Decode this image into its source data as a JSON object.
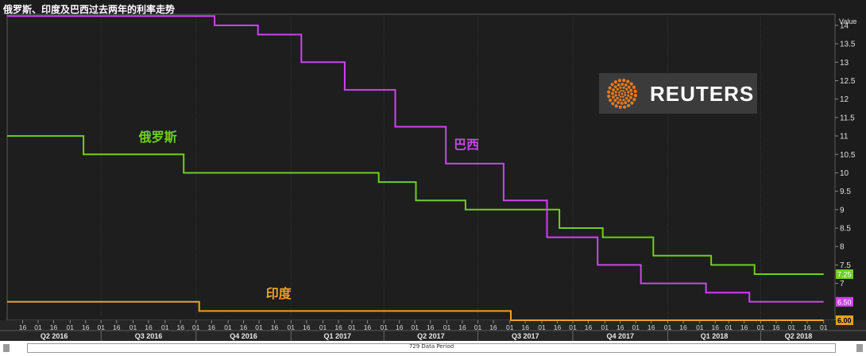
{
  "title": "俄罗斯、印度及巴西过去两年的利率走势",
  "status_bar": {
    "period_label": "729 Data Period"
  },
  "logo": {
    "text": "REUTERS"
  },
  "chart_data": {
    "type": "line",
    "ylabel": "Value",
    "ylim": [
      6,
      14.3
    ],
    "yticks": [
      7,
      7.5,
      8,
      8.5,
      9,
      9.5,
      10,
      10.5,
      11,
      11.5,
      12,
      12.5,
      13,
      13.5,
      14
    ],
    "ytick_labels": [
      "7",
      "7.5",
      "8",
      "8.5",
      "9",
      "9.5",
      "10",
      "10.5",
      "11",
      "11.5",
      "12",
      "12.5",
      "13",
      "13.5",
      "14"
    ],
    "x_range": [
      "2016-04-01",
      "2018-06-12"
    ],
    "x_day_ticks": [
      "2016-04-16",
      "2016-05-01",
      "2016-05-16",
      "2016-06-01",
      "2016-06-16",
      "2016-07-01",
      "2016-07-16",
      "2016-08-01",
      "2016-08-16",
      "2016-09-01",
      "2016-09-16",
      "2016-10-01",
      "2016-10-16",
      "2016-11-01",
      "2016-11-16",
      "2016-12-01",
      "2016-12-16",
      "2017-01-01",
      "2017-01-16",
      "2017-02-01",
      "2017-02-16",
      "2017-03-01",
      "2017-03-16",
      "2017-04-01",
      "2017-04-16",
      "2017-05-01",
      "2017-05-16",
      "2017-06-01",
      "2017-06-16",
      "2017-07-01",
      "2017-07-16",
      "2017-08-01",
      "2017-08-16",
      "2017-09-01",
      "2017-09-16",
      "2017-10-01",
      "2017-10-16",
      "2017-11-01",
      "2017-11-16",
      "2017-12-01",
      "2017-12-16",
      "2018-01-01",
      "2018-01-16",
      "2018-02-01",
      "2018-02-16",
      "2018-03-01",
      "2018-03-16",
      "2018-04-01",
      "2018-04-16",
      "2018-05-01",
      "2018-05-16",
      "2018-06-01"
    ],
    "quarters": [
      {
        "label": "Q2 2016",
        "start": "2016-04-01"
      },
      {
        "label": "Q3 2016",
        "start": "2016-07-01"
      },
      {
        "label": "Q4 2016",
        "start": "2016-10-01"
      },
      {
        "label": "Q1 2017",
        "start": "2017-01-01"
      },
      {
        "label": "Q2 2017",
        "start": "2017-04-01"
      },
      {
        "label": "Q3 2017",
        "start": "2017-07-01"
      },
      {
        "label": "Q4 2017",
        "start": "2017-10-01"
      },
      {
        "label": "Q1 2018",
        "start": "2018-01-01"
      },
      {
        "label": "Q2 2018",
        "start": "2018-04-01"
      }
    ],
    "series": [
      {
        "name": "俄罗斯",
        "color": "#6fcf1f",
        "last_value_label": "7.25",
        "label_position": {
          "date": "2016-08-25",
          "value": 10.85
        },
        "points": [
          [
            "2016-04-01",
            11
          ],
          [
            "2016-06-14",
            11
          ],
          [
            "2016-06-14",
            10.5
          ],
          [
            "2016-09-19",
            10.5
          ],
          [
            "2016-09-19",
            10
          ],
          [
            "2017-03-27",
            10
          ],
          [
            "2017-03-27",
            9.75
          ],
          [
            "2017-05-02",
            9.75
          ],
          [
            "2017-05-02",
            9.25
          ],
          [
            "2017-06-19",
            9.25
          ],
          [
            "2017-06-19",
            9
          ],
          [
            "2017-09-18",
            9
          ],
          [
            "2017-09-18",
            8.5
          ],
          [
            "2017-10-30",
            8.5
          ],
          [
            "2017-10-30",
            8.25
          ],
          [
            "2017-12-18",
            8.25
          ],
          [
            "2017-12-18",
            7.75
          ],
          [
            "2018-02-12",
            7.75
          ],
          [
            "2018-02-12",
            7.5
          ],
          [
            "2018-03-26",
            7.5
          ],
          [
            "2018-03-26",
            7.25
          ],
          [
            "2018-06-01",
            7.25
          ]
        ]
      },
      {
        "name": "巴西",
        "color": "#cc44ee",
        "last_value_label": "6.50",
        "label_position": {
          "date": "2017-06-20",
          "value": 10.65
        },
        "points": [
          [
            "2016-04-01",
            14.25
          ],
          [
            "2016-10-19",
            14.25
          ],
          [
            "2016-10-19",
            14
          ],
          [
            "2016-11-30",
            14
          ],
          [
            "2016-11-30",
            13.75
          ],
          [
            "2017-01-11",
            13.75
          ],
          [
            "2017-01-11",
            13
          ],
          [
            "2017-02-22",
            13
          ],
          [
            "2017-02-22",
            12.25
          ],
          [
            "2017-04-12",
            12.25
          ],
          [
            "2017-04-12",
            11.25
          ],
          [
            "2017-05-31",
            11.25
          ],
          [
            "2017-05-31",
            10.25
          ],
          [
            "2017-07-26",
            10.25
          ],
          [
            "2017-07-26",
            9.25
          ],
          [
            "2017-09-06",
            9.25
          ],
          [
            "2017-09-06",
            8.25
          ],
          [
            "2017-10-25",
            8.25
          ],
          [
            "2017-10-25",
            7.5
          ],
          [
            "2017-12-06",
            7.5
          ],
          [
            "2017-12-06",
            7
          ],
          [
            "2018-02-07",
            7
          ],
          [
            "2018-02-07",
            6.75
          ],
          [
            "2018-03-21",
            6.75
          ],
          [
            "2018-03-21",
            6.5
          ],
          [
            "2018-06-01",
            6.5
          ]
        ]
      },
      {
        "name": "印度",
        "color": "#f0a020",
        "last_value_label": "6.00",
        "label_position": {
          "date": "2016-12-20",
          "value": 6.6
        },
        "points": [
          [
            "2016-04-01",
            6.5
          ],
          [
            "2016-10-04",
            6.5
          ],
          [
            "2016-10-04",
            6.25
          ],
          [
            "2017-08-02",
            6.25
          ],
          [
            "2017-08-02",
            6
          ],
          [
            "2018-06-01",
            6
          ]
        ]
      }
    ]
  }
}
